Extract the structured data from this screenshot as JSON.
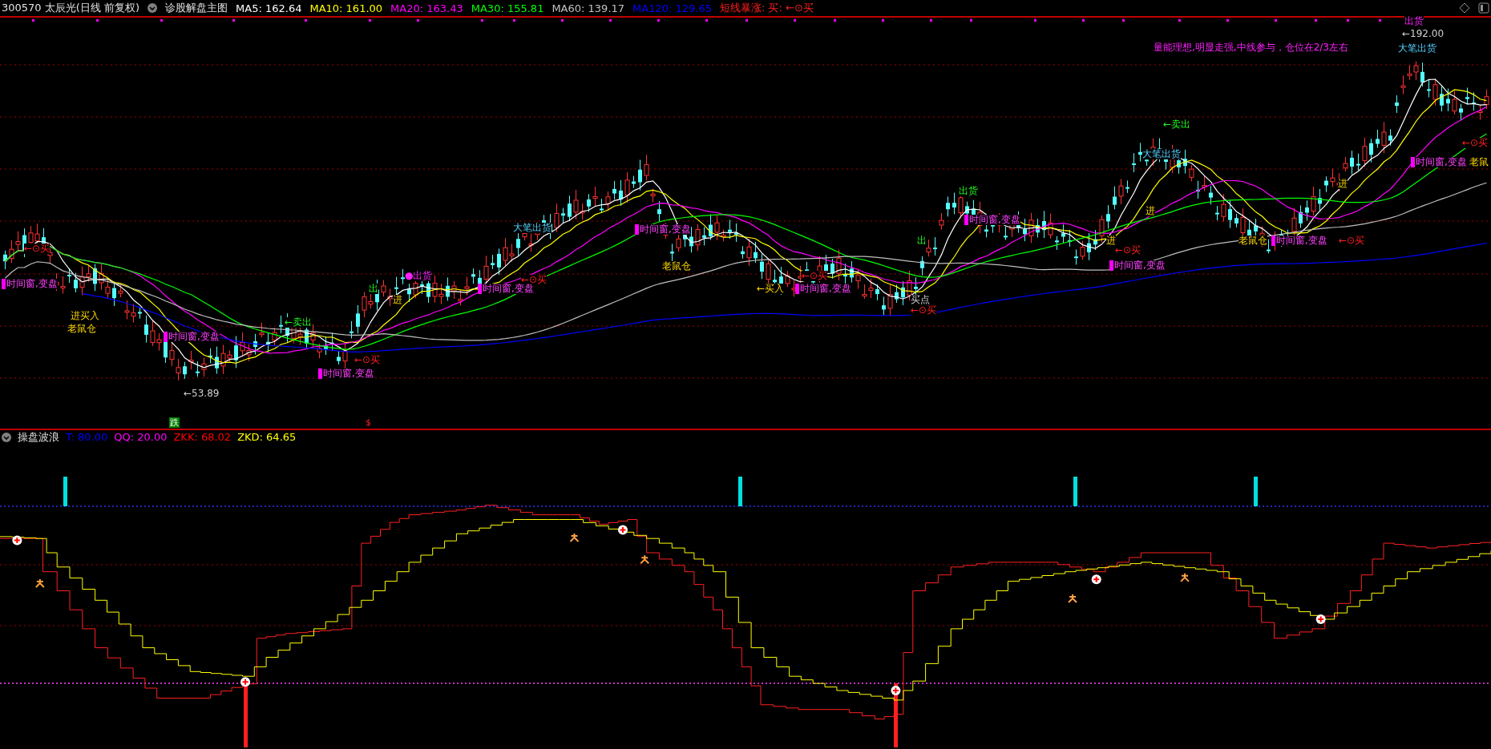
{
  "title_bar": {
    "code_name": "300570 太辰光(日线 前复权)",
    "indicator": "诊股解盘主图",
    "ma": [
      {
        "label": "MA5: 162.64",
        "color": "#ffffff"
      },
      {
        "label": "MA10: 161.00",
        "color": "#ffff00"
      },
      {
        "label": "MA20: 163.43",
        "color": "#ff00ff"
      },
      {
        "label": "MA30: 155.81",
        "color": "#00ff00"
      },
      {
        "label": "MA60: 139.17",
        "color": "#c0c0c0"
      },
      {
        "label": "MA120: 129.65",
        "color": "#0000ff"
      }
    ],
    "signal": "短线暴涨: 买: ←⊙买"
  },
  "main_chart": {
    "labels": [
      {
        "text": "出货",
        "kind": "note"
      },
      {
        "text": "←192.00",
        "kind": "info"
      },
      {
        "text": "量能理想,明显走强,中线参与，仓位在2/3左右",
        "kind": "note"
      },
      {
        "text": "大笔出货",
        "kind": "big"
      },
      {
        "text": "←卖出",
        "kind": "exit"
      },
      {
        "text": "←⊙买",
        "kind": "buy"
      },
      {
        "text": "大笔出货",
        "kind": "big"
      },
      {
        "text": "时间窗,变盘",
        "kind": "window"
      },
      {
        "text": "老鼠",
        "kind": "enter"
      },
      {
        "text": "进",
        "kind": "enter"
      },
      {
        "text": "出货",
        "kind": "exit"
      },
      {
        "text": "进",
        "kind": "enter"
      },
      {
        "text": "时间窗,变盘",
        "kind": "window"
      },
      {
        "text": "大笔出货",
        "kind": "big"
      },
      {
        "text": "时间窗,变盘",
        "kind": "window"
      },
      {
        "text": "出",
        "kind": "exit"
      },
      {
        "text": "进",
        "kind": "enter"
      },
      {
        "text": "老鼠仓",
        "kind": "enter"
      },
      {
        "text": "时间窗,变盘",
        "kind": "window"
      },
      {
        "text": "←⊙买",
        "kind": "buy"
      },
      {
        "text": "←⊙买",
        "kind": "buy"
      },
      {
        "text": "←⊙买",
        "kind": "buy"
      },
      {
        "text": "时间窗,变盘",
        "kind": "window"
      },
      {
        "text": "老鼠仓",
        "kind": "enter"
      },
      {
        "text": "●出货",
        "kind": "note"
      },
      {
        "text": "←⊙买",
        "kind": "buy"
      },
      {
        "text": "←⊙买",
        "kind": "buy"
      },
      {
        "text": "时间窗,变盘",
        "kind": "window"
      },
      {
        "text": "出",
        "kind": "exit"
      },
      {
        "text": "时间窗,变盘",
        "kind": "window"
      },
      {
        "text": "←买入",
        "kind": "enter"
      },
      {
        "text": "时间窗,变盘",
        "kind": "window"
      },
      {
        "text": "进",
        "kind": "enter"
      },
      {
        "text": "买点",
        "kind": "info"
      },
      {
        "text": "←⊙买",
        "kind": "buy"
      },
      {
        "text": "进买入",
        "kind": "enter"
      },
      {
        "text": "←卖出",
        "kind": "exit"
      },
      {
        "text": "老鼠仓",
        "kind": "enter"
      },
      {
        "text": "时间窗,变盘",
        "kind": "window"
      },
      {
        "text": "←⊙买",
        "kind": "buy"
      },
      {
        "text": "时间窗,变盘",
        "kind": "window"
      },
      {
        "text": "←53.89",
        "kind": "info"
      }
    ],
    "markers": [
      {
        "text": "跌",
        "kind": "drop"
      },
      {
        "text": "$",
        "kind": "dollar"
      }
    ]
  },
  "indicator_panel": {
    "name": "操盘波浪",
    "values": [
      {
        "label": "T: 80.00",
        "color": "#0000ff"
      },
      {
        "label": "QQ: 20.00",
        "color": "#ff00ff"
      },
      {
        "label": "ZKK: 68.02",
        "color": "#ff0000"
      },
      {
        "label": "ZKD: 64.65",
        "color": "#ffff00"
      }
    ]
  }
}
